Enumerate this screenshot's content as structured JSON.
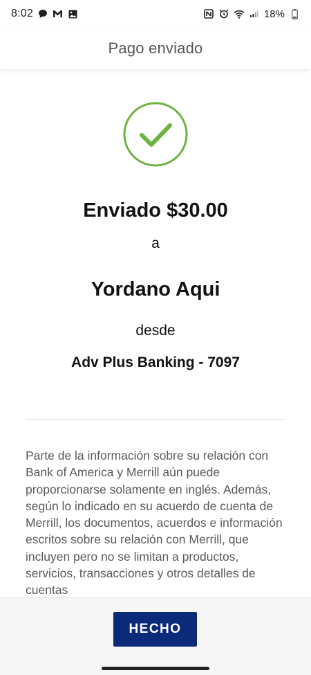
{
  "status_bar": {
    "time": "8:02",
    "battery": "18%",
    "left_icons": [
      "chat-bubble-icon",
      "gmail-icon",
      "gallery-icon"
    ],
    "right_icons": [
      "nfc-icon",
      "alarm-icon",
      "wifi-icon",
      "signal-icon",
      "battery-icon"
    ]
  },
  "header": {
    "title": "Pago enviado"
  },
  "confirmation": {
    "icon": "check-circle-icon",
    "sent_amount": "Enviado $30.00",
    "to_word": "a",
    "recipient": "Yordano Aqui",
    "from_word": "desde",
    "account": "Adv Plus Banking - 7097"
  },
  "disclaimer": {
    "text": "Parte de la información sobre su relación con Bank of America y Merrill aún puede proporcionarse solamente en inglés. Además, según lo indicado en su acuerdo de cuenta de Merrill, los documentos, acuerdos e información escritos sobre su relación con Merrill, que incluyen pero no se limitan a productos, servicios, transacciones y otros detalles de cuentas"
  },
  "footer": {
    "done_label": "HECHO"
  },
  "colors": {
    "success_green": "#6db33f",
    "button_navy": "#0b2a7a",
    "header_text": "#555555",
    "disclaimer_text": "#5a5a5a"
  }
}
